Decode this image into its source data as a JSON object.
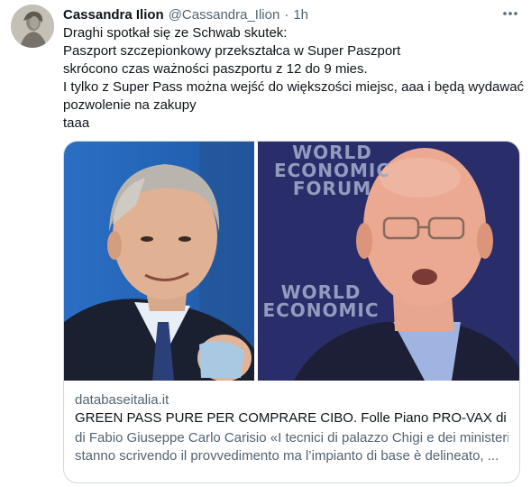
{
  "author": {
    "display_name": "Cassandra Ilion",
    "handle": "@Cassandra_Ilion",
    "separator": "·",
    "time": "1h",
    "avatar_icon": "statue-avatar-icon"
  },
  "more_icon": "more-horizontal-icon",
  "tweet": {
    "lines": [
      "Draghi spotkał się ze Schwab skutek:",
      "Paszport szczepionkowy przekształca w Super Paszport",
      "skrócono czas ważności paszportu z 12 do 9 mies.",
      "I tylko z Super Pass można wejść do większości miejsc, aaa i będą wydawać",
      "pozwolenie na zakupy",
      "taaa"
    ]
  },
  "card": {
    "wef_logo_top": [
      "WORLD",
      "ECONOMIC",
      "FORUM"
    ],
    "wef_logo_bottom": [
      "WORLD",
      "ECONOMIC"
    ],
    "domain": "databaseitalia.it",
    "title": "GREEN PASS PURE PER COMPRARE CIBO. Folle Piano PRO-VAX di D...",
    "description_lines": [
      "di Fabio Giuseppe Carlo Carisio «I tecnici di palazzo Chigi e dei ministeri",
      "stanno scrivendo il provvedimento ma l’impianto di base è delineato, ..."
    ]
  },
  "colors": {
    "text_primary": "#0f1419",
    "text_secondary": "#536471",
    "border": "#cfd9de"
  }
}
